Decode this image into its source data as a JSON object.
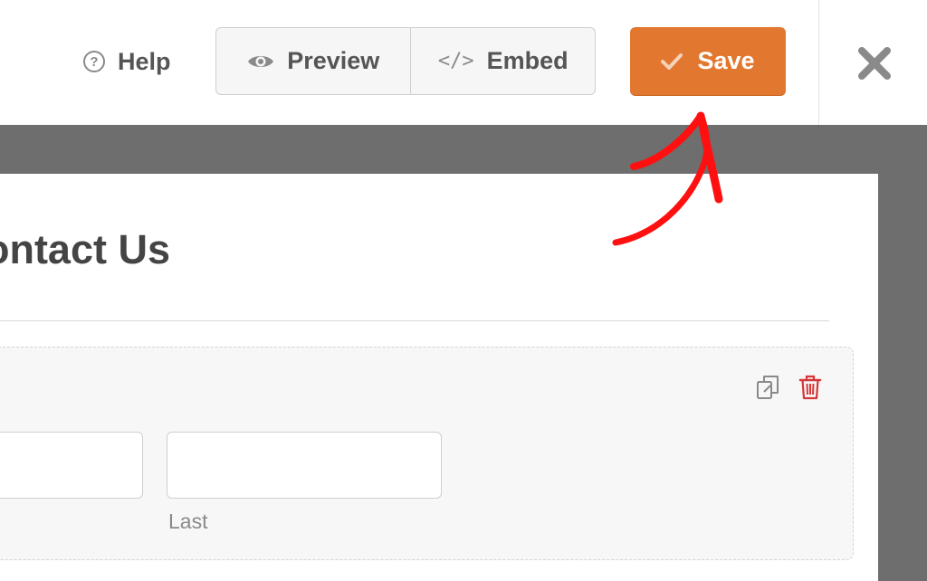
{
  "toolbar": {
    "help_label": "Help",
    "help_icon": "question-circle-icon",
    "preview_label": "Preview",
    "preview_icon": "eye-icon",
    "embed_label": "Embed",
    "embed_icon_glyph": "</>",
    "save_label": "Save",
    "save_icon": "check-icon",
    "close_icon": "close-x-icon"
  },
  "colors": {
    "save_bg": "#e27730",
    "annotation": "#ff0000",
    "backdrop": "#6e6e6e",
    "trash": "#d63638"
  },
  "form": {
    "title": "Contact Us",
    "name_field": {
      "first_value": "",
      "last_value": "",
      "last_sublabel": "Last"
    },
    "actions": {
      "duplicate_icon": "duplicate-icon",
      "delete_icon": "trash-icon"
    }
  }
}
